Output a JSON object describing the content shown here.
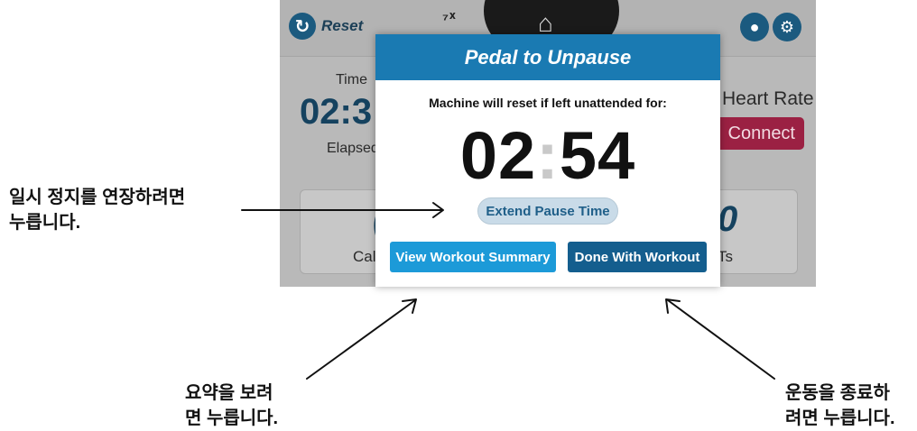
{
  "screen": {
    "reset_label": "Reset",
    "signal_text": "⁷ᕁ",
    "home_icon": "home-icon",
    "time_label": "Time",
    "time_value": "02:3",
    "elapsed_label": "Elapsed",
    "heart_rate_label": "Heart Rate",
    "connect_label": "Connect",
    "card_left_text": "Cal",
    "card_right_text": "Ts",
    "card_left_big": "(",
    "card_right_big": "0"
  },
  "modal": {
    "title": "Pedal to Unpause",
    "message": "Machine will reset if left unattended for:",
    "timer_minutes": "02",
    "timer_colon": ":",
    "timer_seconds": "54",
    "extend_label": "Extend Pause Time",
    "summary_label": "View Workout Summary",
    "done_label": "Done With Workout"
  },
  "annotations": {
    "extend_note_line1": "일시 정지를 연장하려면",
    "extend_note_line2": "누릅니다.",
    "summary_note_line1": "요약을 보려",
    "summary_note_line2": "면 누릅니다.",
    "done_note_line1": "운동을 종료하",
    "done_note_line2": "려면 누릅니다."
  },
  "colors": {
    "modal_header": "#1a7ab2",
    "summary_button": "#1c9ad8",
    "done_button": "#145e8e",
    "connect_button": "#9b2143"
  }
}
